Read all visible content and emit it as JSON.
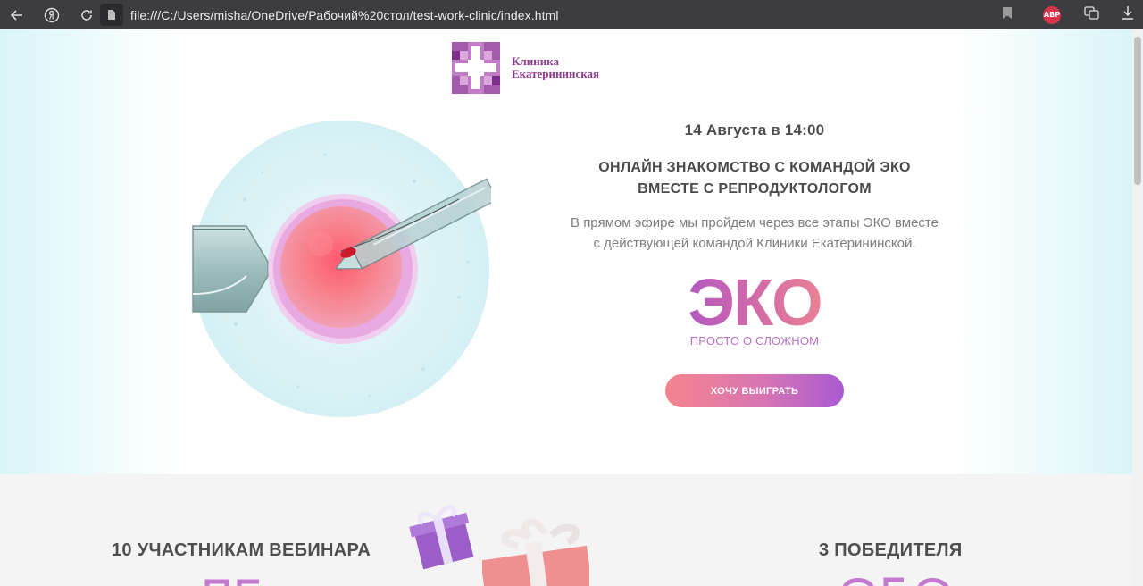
{
  "browser": {
    "url": "file:///C:/Users/misha/OneDrive/Рабочий%20стол/test-work-clinic/index.html",
    "adblock_label": "ABP",
    "icons": [
      "back-arrow-icon",
      "yandex-icon",
      "reload-icon",
      "file-icon",
      "bookmark-icon",
      "collections-icon",
      "download-icon"
    ]
  },
  "logo": {
    "line1": "Клиника",
    "line2": "Екатерининская",
    "color": "#8c3a8e"
  },
  "event": {
    "date": "14 Августа в 14:00",
    "headline_line1": "ОНЛАЙН ЗНАКОМСТВО С КОМАНДОЙ ЭКО",
    "headline_line2": "ВМЕСТЕ С РЕПРОДУКТОЛОГОМ",
    "subtitle_line1": "В прямом эфире мы пройдем через все этапы ЭКО вместе",
    "subtitle_line2": "с действующей командой Клиники Екатерининской.",
    "eko_word": "ЭКО",
    "eko_tagline": "ПРОСТО О СЛОЖНОМ",
    "cta_label": "ХОЧУ ВЫИГРАТЬ"
  },
  "prizes": {
    "left_title": "10 УЧАСТНИКАМ ВЕБИНАРА",
    "right_title": "3 ПОБЕДИТЕЛЯ"
  },
  "colors": {
    "accent_purple": "#a95ad1",
    "accent_pink": "#f6848e",
    "text_dark": "#4a4a4a",
    "hero_side": "#d9f4f7"
  }
}
